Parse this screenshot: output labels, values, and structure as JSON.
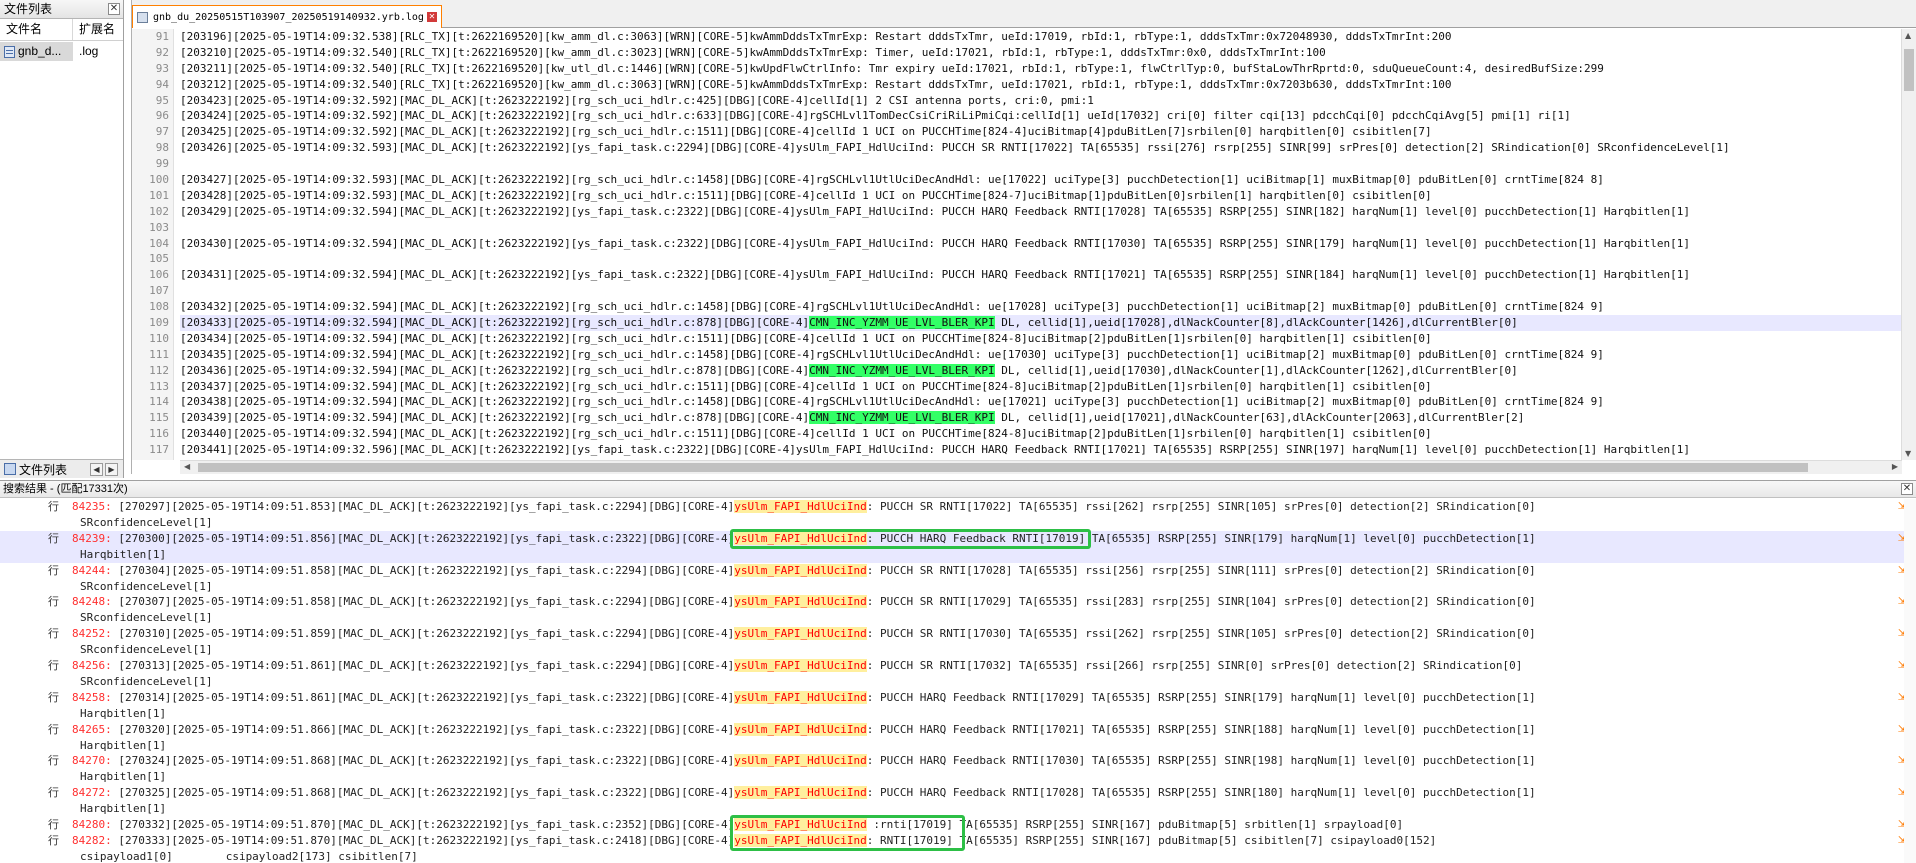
{
  "file_panel": {
    "title": "文件列表",
    "close_glyph": "✕",
    "col_name": "文件名",
    "col_ext": "扩展名",
    "files": [
      {
        "name": "gnb_d...",
        "ext": ".log"
      }
    ],
    "bottom_tab": "文件列表",
    "arrows": [
      "◀",
      "▶"
    ]
  },
  "editor": {
    "tab_title": "gnb_du_20250515T103907_20250519140932.yrb.log",
    "tab_close_glyph": "✕",
    "highlight_term": "CMN_INC_YZMM_UE_LVL_BLER_KPI",
    "lines": [
      {
        "num": "91",
        "text": "[203196][2025-05-19T14:09:32.538][RLC_TX][t:2622169520][kw_amm_dl.c:3063][WRN][CORE-5]kwAmmDddsTxTmrExp: Restart dddsTxTmr, ueId:17019, rbId:1, rbType:1, dddsTxTmr:0x72048930, dddsTxTmrInt:200"
      },
      {
        "num": "92",
        "text": "[203210][2025-05-19T14:09:32.540][RLC_TX][t:2622169520][kw_amm_dl.c:3023][WRN][CORE-5]kwAmmDddsTxTmrExp: Timer, ueId:17021, rbId:1, rbType:1, dddsTxTmr:0x0, dddsTxTmrInt:100"
      },
      {
        "num": "93",
        "text": "[203211][2025-05-19T14:09:32.540][RLC_TX][t:2622169520][kw_utl_dl.c:1446][WRN][CORE-5]kwUpdFlwCtrlInfo: Tmr expiry ueId:17021, rbId:1, rbType:1, flwCtrlTyp:0, bufStaLowThrRprtd:0, sduQueueCount:4, desiredBufSize:299"
      },
      {
        "num": "94",
        "text": "[203212][2025-05-19T14:09:32.540][RLC_TX][t:2622169520][kw_amm_dl.c:3063][WRN][CORE-5]kwAmmDddsTxTmrExp: Restart dddsTxTmr, ueId:17021, rbId:1, rbType:1, dddsTxTmr:0x7203b630, dddsTxTmrInt:100"
      },
      {
        "num": "95",
        "text": "[203423][2025-05-19T14:09:32.592][MAC_DL_ACK][t:2623222192][rg_sch_uci_hdlr.c:425][DBG][CORE-4]cellId[1] 2 CSI antenna ports, cri:0, pmi:1"
      },
      {
        "num": "96",
        "text": "[203424][2025-05-19T14:09:32.592][MAC_DL_ACK][t:2623222192][rg_sch_uci_hdlr.c:633][DBG][CORE-4]rgSCHLvl1TomDecCsiCriRiLiPmiCqi:cellId[1] ueId[17032] cri[0] filter cqi[13] pdcchCqi[0] pdcchCqiAvg[5] pmi[1] ri[1]"
      },
      {
        "num": "97",
        "text": "[203425][2025-05-19T14:09:32.592][MAC_DL_ACK][t:2623222192][rg_sch_uci_hdlr.c:1511][DBG][CORE-4]cellId 1 UCI on PUCCHTime[824-4]uciBitmap[4]pduBitLen[7]srbilen[0] harqbitlen[0] csibitlen[7]"
      },
      {
        "num": "98",
        "text": "[203426][2025-05-19T14:09:32.593][MAC_DL_ACK][t:2623222192][ys_fapi_task.c:2294][DBG][CORE-4]ysUlm_FAPI_HdlUciInd: PUCCH SR RNTI[17022] TA[65535] rssi[276] rsrp[255] SINR[99] srPres[0] detection[2] SRindication[0] SRconfidenceLevel[1]"
      },
      {
        "num": "99",
        "text": ""
      },
      {
        "num": "100",
        "text": "[203427][2025-05-19T14:09:32.593][MAC_DL_ACK][t:2623222192][rg_sch_uci_hdlr.c:1458][DBG][CORE-4]rgSCHLvl1UtlUciDecAndHdl: ue[17022] uciType[3] pucchDetection[1] uciBitmap[1] muxBitmap[0] pduBitLen[0] crntTime[824 8]"
      },
      {
        "num": "101",
        "text": "[203428][2025-05-19T14:09:32.593][MAC_DL_ACK][t:2623222192][rg_sch_uci_hdlr.c:1511][DBG][CORE-4]cellId 1 UCI on PUCCHTime[824-7]uciBitmap[1]pduBitLen[0]srbilen[1] harqbitlen[0] csibitlen[0]"
      },
      {
        "num": "102",
        "text": "[203429][2025-05-19T14:09:32.594][MAC_DL_ACK][t:2623222192][ys_fapi_task.c:2322][DBG][CORE-4]ysUlm_FAPI_HdlUciInd: PUCCH HARQ Feedback RNTI[17028] TA[65535] RSRP[255] SINR[182] harqNum[1] level[0] pucchDetection[1] Harqbitlen[1]"
      },
      {
        "num": "103",
        "text": ""
      },
      {
        "num": "104",
        "text": "[203430][2025-05-19T14:09:32.594][MAC_DL_ACK][t:2623222192][ys_fapi_task.c:2322][DBG][CORE-4]ysUlm_FAPI_HdlUciInd: PUCCH HARQ Feedback RNTI[17030] TA[65535] RSRP[255] SINR[179] harqNum[1] level[0] pucchDetection[1] Harqbitlen[1]"
      },
      {
        "num": "105",
        "text": ""
      },
      {
        "num": "106",
        "text": "[203431][2025-05-19T14:09:32.594][MAC_DL_ACK][t:2623222192][ys_fapi_task.c:2322][DBG][CORE-4]ysUlm_FAPI_HdlUciInd: PUCCH HARQ Feedback RNTI[17021] TA[65535] RSRP[255] SINR[184] harqNum[1] level[0] pucchDetection[1] Harqbitlen[1]"
      },
      {
        "num": "107",
        "text": ""
      },
      {
        "num": "108",
        "text": "[203432][2025-05-19T14:09:32.594][MAC_DL_ACK][t:2623222192][rg_sch_uci_hdlr.c:1458][DBG][CORE-4]rgSCHLvl1UtlUciDecAndHdl: ue[17028] uciType[3] pucchDetection[1] uciBitmap[2] muxBitmap[0] pduBitLen[0] crntTime[824 9]"
      },
      {
        "num": "109",
        "text": "[203433][2025-05-19T14:09:32.594][MAC_DL_ACK][t:2623222192][rg_sch_uci_hdlr.c:878][DBG][CORE-4]CMN_INC_YZMM_UE_LVL_BLER_KPI DL, cellid[1],ueid[17028],dlNackCounter[8],dlAckCounter[1426],dlCurrentBler[0]"
      },
      {
        "num": "110",
        "text": "[203434][2025-05-19T14:09:32.594][MAC_DL_ACK][t:2623222192][rg_sch_uci_hdlr.c:1511][DBG][CORE-4]cellId 1 UCI on PUCCHTime[824-8]uciBitmap[2]pduBitLen[1]srbilen[0] harqbitlen[1] csibitlen[0]"
      },
      {
        "num": "111",
        "text": "[203435][2025-05-19T14:09:32.594][MAC_DL_ACK][t:2623222192][rg_sch_uci_hdlr.c:1458][DBG][CORE-4]rgSCHLvl1UtlUciDecAndHdl: ue[17030] uciType[3] pucchDetection[1] uciBitmap[2] muxBitmap[0] pduBitLen[0] crntTime[824 9]"
      },
      {
        "num": "112",
        "text": "[203436][2025-05-19T14:09:32.594][MAC_DL_ACK][t:2623222192][rg_sch_uci_hdlr.c:878][DBG][CORE-4]CMN_INC_YZMM_UE_LVL_BLER_KPI DL, cellid[1],ueid[17030],dlNackCounter[1],dlAckCounter[1262],dlCurrentBler[0]"
      },
      {
        "num": "113",
        "text": "[203437][2025-05-19T14:09:32.594][MAC_DL_ACK][t:2623222192][rg_sch_uci_hdlr.c:1511][DBG][CORE-4]cellId 1 UCI on PUCCHTime[824-8]uciBitmap[2]pduBitLen[1]srbilen[0] harqbitlen[1] csibitlen[0]"
      },
      {
        "num": "114",
        "text": "[203438][2025-05-19T14:09:32.594][MAC_DL_ACK][t:2623222192][rg_sch_uci_hdlr.c:1458][DBG][CORE-4]rgSCHLvl1UtlUciDecAndHdl: ue[17021] uciType[3] pucchDetection[1] uciBitmap[2] muxBitmap[0] pduBitLen[0] crntTime[824 9]"
      },
      {
        "num": "115",
        "text": "[203439][2025-05-19T14:09:32.594][MAC_DL_ACK][t:2623222192][rg_sch_uci_hdlr.c:878][DBG][CORE-4]CMN_INC_YZMM_UE_LVL_BLER_KPI DL, cellid[1],ueid[17021],dlNackCounter[63],dlAckCounter[2063],dlCurrentBler[2]"
      },
      {
        "num": "116",
        "text": "[203440][2025-05-19T14:09:32.594][MAC_DL_ACK][t:2623222192][rg_sch_uci_hdlr.c:1511][DBG][CORE-4]cellId 1 UCI on PUCCHTime[824-8]uciBitmap[2]pduBitLen[1]srbilen[0] harqbitlen[1] csibitlen[0]"
      },
      {
        "num": "117",
        "text": "[203441][2025-05-19T14:09:32.596][MAC_DL_ACK][t:2623222192][ys_fapi_task.c:2322][DBG][CORE-4]ysUlm_FAPI_HdlUciInd: PUCCH HARQ Feedback RNTI[17021] TA[65535] RSRP[255] SINR[197] harqNum[1] level[0] pucchDetection[1] Harqbitlen[1]"
      }
    ]
  },
  "results": {
    "title": "搜索结果 - (匹配17331次)",
    "close_glyph": "✕",
    "row_mark": "行",
    "search_term": "ysUlm_FAPI_HdlUciInd",
    "rows": [
      {
        "lnum": "84235:",
        "pre": " [270297][2025-05-19T14:09:51.853][MAC_DL_ACK][t:2623222192][ys_fapi_task.c:2294][DBG][CORE-4]",
        "post": ": PUCCH SR RNTI[17022] TA[65535] rssi[262] rsrp[255] SINR[105] srPres[0] detection[2] SRindication[0]",
        "cont": "SRconfidenceLevel[1]"
      },
      {
        "lnum": "84239:",
        "pre": " [270300][2025-05-19T14:09:51.856][MAC_DL_ACK][t:2623222192][ys_fapi_task.c:2322][DBG][CORE-4]",
        "post": ": PUCCH HARQ Feedback RNTI[17019] TA[65535] RSRP[255] SINR[179] harqNum[1] level[0] pucchDetection[1]",
        "cont": "Harqbitlen[1]"
      },
      {
        "lnum": "84244:",
        "pre": " [270304][2025-05-19T14:09:51.858][MAC_DL_ACK][t:2623222192][ys_fapi_task.c:2294][DBG][CORE-4]",
        "post": ": PUCCH SR RNTI[17028] TA[65535] rssi[256] rsrp[255] SINR[111] srPres[0] detection[2] SRindication[0]",
        "cont": "SRconfidenceLevel[1]"
      },
      {
        "lnum": "84248:",
        "pre": " [270307][2025-05-19T14:09:51.858][MAC_DL_ACK][t:2623222192][ys_fapi_task.c:2294][DBG][CORE-4]",
        "post": ": PUCCH SR RNTI[17029] TA[65535] rssi[283] rsrp[255] SINR[104] srPres[0] detection[2] SRindication[0]",
        "cont": "SRconfidenceLevel[1]"
      },
      {
        "lnum": "84252:",
        "pre": " [270310][2025-05-19T14:09:51.859][MAC_DL_ACK][t:2623222192][ys_fapi_task.c:2294][DBG][CORE-4]",
        "post": ": PUCCH SR RNTI[17030] TA[65535] rssi[262] rsrp[255] SINR[105] srPres[0] detection[2] SRindication[0]",
        "cont": "SRconfidenceLevel[1]"
      },
      {
        "lnum": "84256:",
        "pre": " [270313][2025-05-19T14:09:51.861][MAC_DL_ACK][t:2623222192][ys_fapi_task.c:2294][DBG][CORE-4]",
        "post": ": PUCCH SR RNTI[17032] TA[65535] rssi[266] rsrp[255] SINR[0] srPres[0] detection[2] SRindication[0]",
        "cont": "SRconfidenceLevel[1]"
      },
      {
        "lnum": "84258:",
        "pre": " [270314][2025-05-19T14:09:51.861][MAC_DL_ACK][t:2623222192][ys_fapi_task.c:2322][DBG][CORE-4]",
        "post": ": PUCCH HARQ Feedback RNTI[17029] TA[65535] RSRP[255] SINR[179] harqNum[1] level[0] pucchDetection[1]",
        "cont": "Harqbitlen[1]"
      },
      {
        "lnum": "84265:",
        "pre": " [270320][2025-05-19T14:09:51.866][MAC_DL_ACK][t:2623222192][ys_fapi_task.c:2322][DBG][CORE-4]",
        "post": ": PUCCH HARQ Feedback RNTI[17021] TA[65535] RSRP[255] SINR[188] harqNum[1] level[0] pucchDetection[1]",
        "cont": "Harqbitlen[1]"
      },
      {
        "lnum": "84270:",
        "pre": " [270324][2025-05-19T14:09:51.868][MAC_DL_ACK][t:2623222192][ys_fapi_task.c:2322][DBG][CORE-4]",
        "post": ": PUCCH HARQ Feedback RNTI[17030] TA[65535] RSRP[255] SINR[198] harqNum[1] level[0] pucchDetection[1]",
        "cont": "Harqbitlen[1]"
      },
      {
        "lnum": "84272:",
        "pre": " [270325][2025-05-19T14:09:51.868][MAC_DL_ACK][t:2623222192][ys_fapi_task.c:2322][DBG][CORE-4]",
        "post": ": PUCCH HARQ Feedback RNTI[17028] TA[65535] RSRP[255] SINR[180] harqNum[1] level[0] pucchDetection[1]",
        "cont": "Harqbitlen[1]"
      },
      {
        "lnum": "84280:",
        "pre": " [270332][2025-05-19T14:09:51.870][MAC_DL_ACK][t:2623222192][ys_fapi_task.c:2352][DBG][CORE-4]",
        "post": " :rnti[17019] TA[65535] RSRP[255] SINR[167] pduBitmap[5] srbitlen[1] srpayload[0]",
        "cont": null
      },
      {
        "lnum": "84282:",
        "pre": " [270333][2025-05-19T14:09:51.870][MAC_DL_ACK][t:2623222192][ys_fapi_task.c:2418][DBG][CORE-4]",
        "post": ": RNTI[17019] TA[65535] RSRP[255] SINR[167] pduBitmap[5] csibitlen[7] csipayload0[152]",
        "cont": "csipayload1[0]        csipayload2[173] csibitlen[7]"
      }
    ]
  },
  "colors": {
    "kpi_highlight": "#33ff66",
    "match_fg": "#ff0000",
    "match_bg": "#ffef9e",
    "annotation_box": "#2dbf46",
    "tab_border": "#ff8000"
  }
}
